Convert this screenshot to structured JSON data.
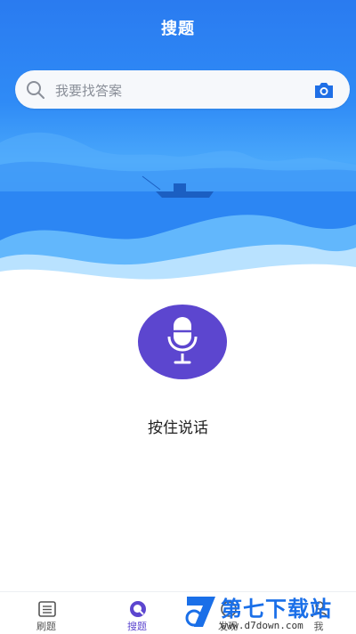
{
  "header": {
    "title": "搜题"
  },
  "search": {
    "placeholder": "我要找答案"
  },
  "voice": {
    "hint": "按住说话"
  },
  "tabbar": {
    "items": [
      {
        "label": "刷题",
        "icon": "list-icon",
        "active": false
      },
      {
        "label": "搜题",
        "icon": "search-tab-icon",
        "active": true
      },
      {
        "label": "发现",
        "icon": "discover-icon",
        "active": false
      },
      {
        "label": "我",
        "icon": "profile-icon",
        "active": false
      }
    ]
  },
  "watermark": {
    "brand": "第七下载站",
    "url": "www.d7down.com"
  },
  "colors": {
    "hero_blue": "#2a7bf0",
    "accent_purple": "#5c46cf"
  }
}
